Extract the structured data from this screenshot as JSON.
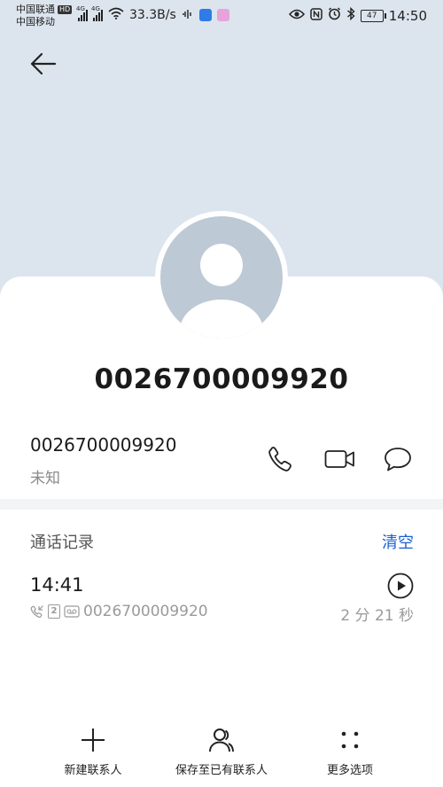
{
  "status_bar": {
    "carrier1": "中国联通",
    "carrier1_badge": "HD",
    "carrier2": "中国移动",
    "net1": "4G",
    "net2": "4G",
    "speed": "33.3B/s",
    "battery": "47",
    "time": "14:50"
  },
  "contact": {
    "name": "0026700009920",
    "number": "0026700009920",
    "location": "未知"
  },
  "call_log": {
    "title": "通话记录",
    "clear_label": "清空",
    "entries": [
      {
        "time": "14:41",
        "sim": "2",
        "number": "0026700009920",
        "duration": "2 分 21 秒"
      }
    ]
  },
  "bottom_actions": {
    "new_contact": "新建联系人",
    "save_existing": "保存至已有联系人",
    "more_options": "更多选项"
  },
  "colors": {
    "header_bg": "#dce5ee",
    "accent": "#1a5fd0",
    "avatar_bg": "#bdc9d5"
  }
}
